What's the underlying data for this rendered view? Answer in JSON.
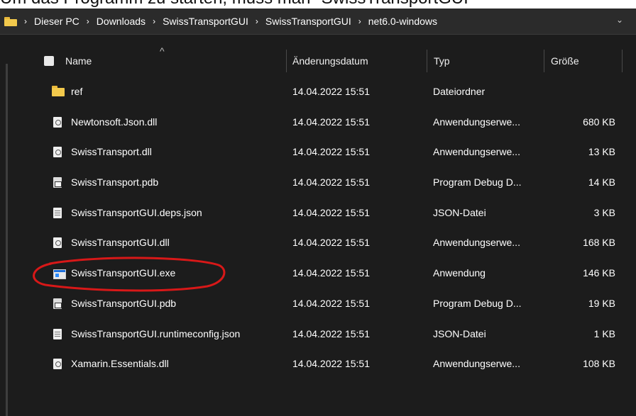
{
  "caption": "Um das Programm zu starten, muss man \"SwissTransportGUI",
  "address": {
    "crumbs": [
      "Dieser PC",
      "Downloads",
      "SwissTransportGUI",
      "SwissTransportGUI",
      "net6.0-windows"
    ],
    "separator": "›",
    "expand": "⌄"
  },
  "columns": {
    "name": "Name",
    "date": "Änderungsdatum",
    "type": "Typ",
    "size": "Größe",
    "sort_caret": "^"
  },
  "files": [
    {
      "name": "ref",
      "date": "14.04.2022 15:51",
      "type": "Dateiordner",
      "size": "",
      "icon": "folder-icon",
      "kind": "folder"
    },
    {
      "name": "Newtonsoft.Json.dll",
      "date": "14.04.2022 15:51",
      "type": "Anwendungserwe...",
      "size": "680 KB",
      "icon": "dll-file-icon",
      "kind": "dll"
    },
    {
      "name": "SwissTransport.dll",
      "date": "14.04.2022 15:51",
      "type": "Anwendungserwe...",
      "size": "13 KB",
      "icon": "dll-file-icon",
      "kind": "dll"
    },
    {
      "name": "SwissTransport.pdb",
      "date": "14.04.2022 15:51",
      "type": "Program Debug D...",
      "size": "14 KB",
      "icon": "pdb-file-icon",
      "kind": "pdb"
    },
    {
      "name": "SwissTransportGUI.deps.json",
      "date": "14.04.2022 15:51",
      "type": "JSON-Datei",
      "size": "3 KB",
      "icon": "json-file-icon",
      "kind": "json"
    },
    {
      "name": "SwissTransportGUI.dll",
      "date": "14.04.2022 15:51",
      "type": "Anwendungserwe...",
      "size": "168 KB",
      "icon": "dll-file-icon",
      "kind": "dll"
    },
    {
      "name": "SwissTransportGUI.exe",
      "date": "14.04.2022 15:51",
      "type": "Anwendung",
      "size": "146 KB",
      "icon": "exe-file-icon",
      "kind": "exe"
    },
    {
      "name": "SwissTransportGUI.pdb",
      "date": "14.04.2022 15:51",
      "type": "Program Debug D...",
      "size": "19 KB",
      "icon": "pdb-file-icon",
      "kind": "pdb"
    },
    {
      "name": "SwissTransportGUI.runtimeconfig.json",
      "date": "14.04.2022 15:51",
      "type": "JSON-Datei",
      "size": "1 KB",
      "icon": "json-file-icon",
      "kind": "json"
    },
    {
      "name": "Xamarin.Essentials.dll",
      "date": "14.04.2022 15:51",
      "type": "Anwendungserwe...",
      "size": "108 KB",
      "icon": "dll-file-icon",
      "kind": "dll"
    }
  ],
  "colors": {
    "background": "#1c1c1c",
    "folder": "#f2c94c",
    "annotation": "#d81818"
  }
}
